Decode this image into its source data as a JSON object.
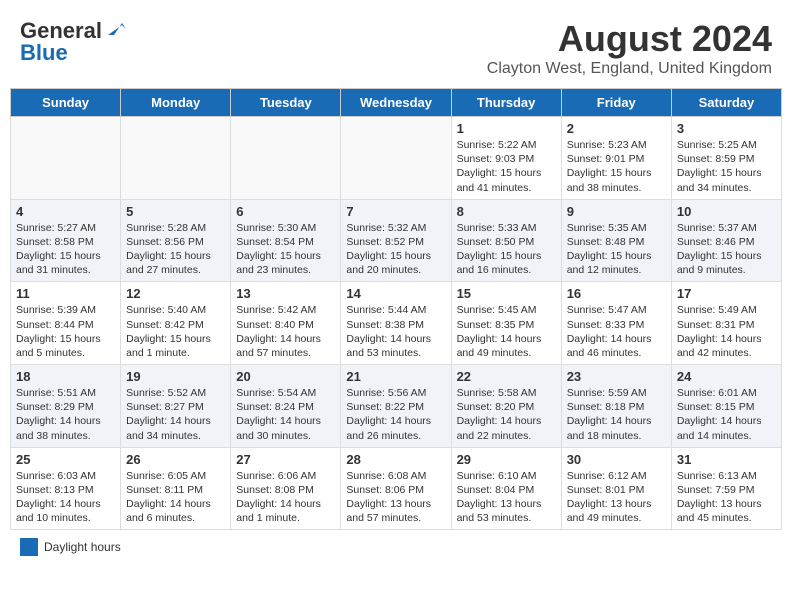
{
  "logo": {
    "line1": "General",
    "line2": "Blue"
  },
  "title": "August 2024",
  "subtitle": "Clayton West, England, United Kingdom",
  "days_of_week": [
    "Sunday",
    "Monday",
    "Tuesday",
    "Wednesday",
    "Thursday",
    "Friday",
    "Saturday"
  ],
  "weeks": [
    [
      {
        "day": "",
        "content": ""
      },
      {
        "day": "",
        "content": ""
      },
      {
        "day": "",
        "content": ""
      },
      {
        "day": "",
        "content": ""
      },
      {
        "day": "1",
        "content": "Sunrise: 5:22 AM\nSunset: 9:03 PM\nDaylight: 15 hours and 41 minutes."
      },
      {
        "day": "2",
        "content": "Sunrise: 5:23 AM\nSunset: 9:01 PM\nDaylight: 15 hours and 38 minutes."
      },
      {
        "day": "3",
        "content": "Sunrise: 5:25 AM\nSunset: 8:59 PM\nDaylight: 15 hours and 34 minutes."
      }
    ],
    [
      {
        "day": "4",
        "content": "Sunrise: 5:27 AM\nSunset: 8:58 PM\nDaylight: 15 hours and 31 minutes."
      },
      {
        "day": "5",
        "content": "Sunrise: 5:28 AM\nSunset: 8:56 PM\nDaylight: 15 hours and 27 minutes."
      },
      {
        "day": "6",
        "content": "Sunrise: 5:30 AM\nSunset: 8:54 PM\nDaylight: 15 hours and 23 minutes."
      },
      {
        "day": "7",
        "content": "Sunrise: 5:32 AM\nSunset: 8:52 PM\nDaylight: 15 hours and 20 minutes."
      },
      {
        "day": "8",
        "content": "Sunrise: 5:33 AM\nSunset: 8:50 PM\nDaylight: 15 hours and 16 minutes."
      },
      {
        "day": "9",
        "content": "Sunrise: 5:35 AM\nSunset: 8:48 PM\nDaylight: 15 hours and 12 minutes."
      },
      {
        "day": "10",
        "content": "Sunrise: 5:37 AM\nSunset: 8:46 PM\nDaylight: 15 hours and 9 minutes."
      }
    ],
    [
      {
        "day": "11",
        "content": "Sunrise: 5:39 AM\nSunset: 8:44 PM\nDaylight: 15 hours and 5 minutes."
      },
      {
        "day": "12",
        "content": "Sunrise: 5:40 AM\nSunset: 8:42 PM\nDaylight: 15 hours and 1 minute."
      },
      {
        "day": "13",
        "content": "Sunrise: 5:42 AM\nSunset: 8:40 PM\nDaylight: 14 hours and 57 minutes."
      },
      {
        "day": "14",
        "content": "Sunrise: 5:44 AM\nSunset: 8:38 PM\nDaylight: 14 hours and 53 minutes."
      },
      {
        "day": "15",
        "content": "Sunrise: 5:45 AM\nSunset: 8:35 PM\nDaylight: 14 hours and 49 minutes."
      },
      {
        "day": "16",
        "content": "Sunrise: 5:47 AM\nSunset: 8:33 PM\nDaylight: 14 hours and 46 minutes."
      },
      {
        "day": "17",
        "content": "Sunrise: 5:49 AM\nSunset: 8:31 PM\nDaylight: 14 hours and 42 minutes."
      }
    ],
    [
      {
        "day": "18",
        "content": "Sunrise: 5:51 AM\nSunset: 8:29 PM\nDaylight: 14 hours and 38 minutes."
      },
      {
        "day": "19",
        "content": "Sunrise: 5:52 AM\nSunset: 8:27 PM\nDaylight: 14 hours and 34 minutes."
      },
      {
        "day": "20",
        "content": "Sunrise: 5:54 AM\nSunset: 8:24 PM\nDaylight: 14 hours and 30 minutes."
      },
      {
        "day": "21",
        "content": "Sunrise: 5:56 AM\nSunset: 8:22 PM\nDaylight: 14 hours and 26 minutes."
      },
      {
        "day": "22",
        "content": "Sunrise: 5:58 AM\nSunset: 8:20 PM\nDaylight: 14 hours and 22 minutes."
      },
      {
        "day": "23",
        "content": "Sunrise: 5:59 AM\nSunset: 8:18 PM\nDaylight: 14 hours and 18 minutes."
      },
      {
        "day": "24",
        "content": "Sunrise: 6:01 AM\nSunset: 8:15 PM\nDaylight: 14 hours and 14 minutes."
      }
    ],
    [
      {
        "day": "25",
        "content": "Sunrise: 6:03 AM\nSunset: 8:13 PM\nDaylight: 14 hours and 10 minutes."
      },
      {
        "day": "26",
        "content": "Sunrise: 6:05 AM\nSunset: 8:11 PM\nDaylight: 14 hours and 6 minutes."
      },
      {
        "day": "27",
        "content": "Sunrise: 6:06 AM\nSunset: 8:08 PM\nDaylight: 14 hours and 1 minute."
      },
      {
        "day": "28",
        "content": "Sunrise: 6:08 AM\nSunset: 8:06 PM\nDaylight: 13 hours and 57 minutes."
      },
      {
        "day": "29",
        "content": "Sunrise: 6:10 AM\nSunset: 8:04 PM\nDaylight: 13 hours and 53 minutes."
      },
      {
        "day": "30",
        "content": "Sunrise: 6:12 AM\nSunset: 8:01 PM\nDaylight: 13 hours and 49 minutes."
      },
      {
        "day": "31",
        "content": "Sunrise: 6:13 AM\nSunset: 7:59 PM\nDaylight: 13 hours and 45 minutes."
      }
    ]
  ],
  "legend": {
    "daylight_label": "Daylight hours"
  }
}
